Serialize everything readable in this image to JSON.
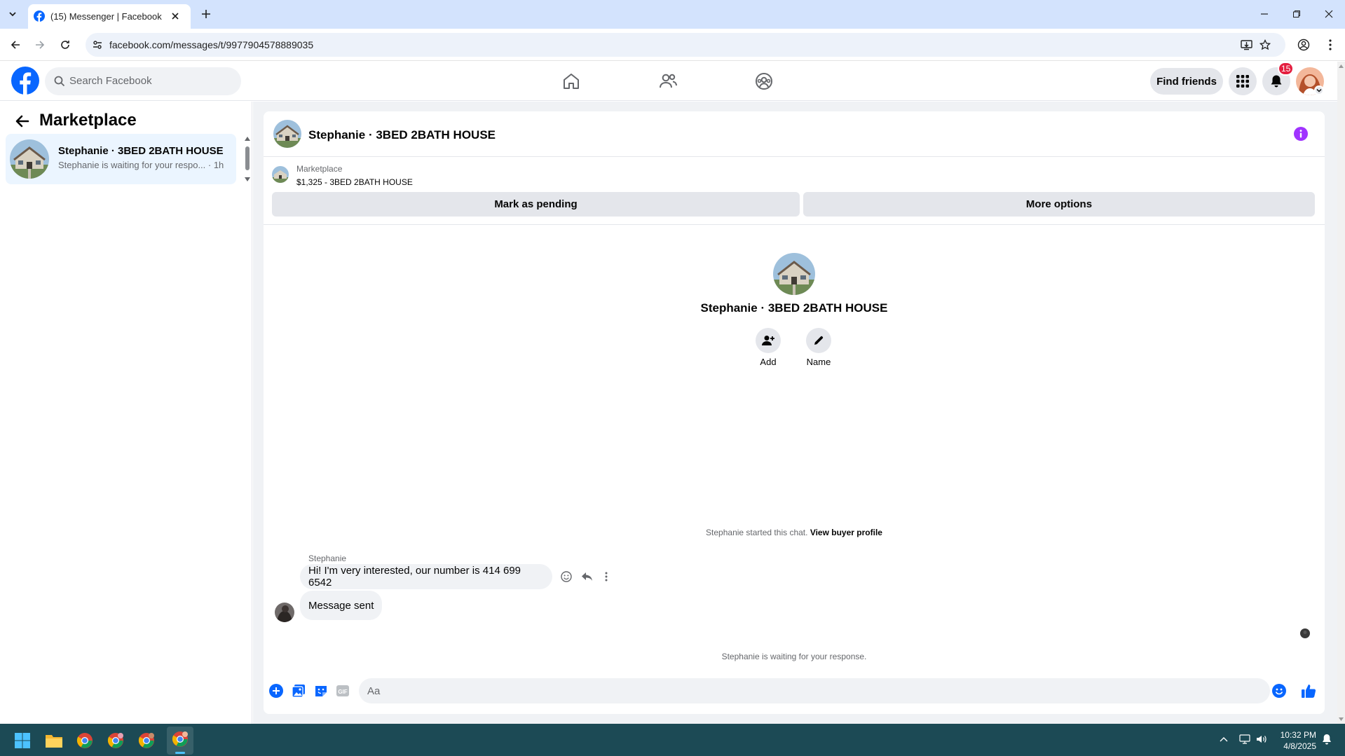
{
  "browser": {
    "tab_title": "(15) Messenger | Facebook",
    "url": "facebook.com/messages/t/9977904578889035"
  },
  "header": {
    "search_placeholder": "Search Facebook",
    "find_friends": "Find friends",
    "notification_count": "15"
  },
  "sidebar": {
    "title": "Marketplace",
    "conversations": [
      {
        "name": "Stephanie · 3BED 2BATH HOUSE",
        "preview": "Stephanie is waiting for your respo... · 1h"
      }
    ]
  },
  "chat": {
    "title": "Stephanie · 3BED 2BATH HOUSE",
    "listing": {
      "label": "Marketplace",
      "price_title": "$1,325 - 3BED 2BATH HOUSE"
    },
    "actions": {
      "mark_pending": "Mark as pending",
      "more_options": "More options"
    },
    "profile": {
      "name": "Stephanie · 3BED 2BATH HOUSE",
      "add_label": "Add",
      "name_label": "Name"
    },
    "started_text": "Stephanie started this chat.",
    "view_buyer_profile": "View buyer profile",
    "sender": "Stephanie",
    "messages": [
      {
        "text": "Hi! I'm very interested, our number is 414 699 6542"
      },
      {
        "text": "Message sent"
      }
    ],
    "waiting_text": "Stephanie is waiting for your response.",
    "composer_placeholder": "Aa"
  },
  "taskbar": {
    "time": "10:32 PM",
    "date": "4/8/2025"
  },
  "colors": {
    "brand": "#0866ff",
    "info": "#a033ff",
    "badge": "#e41e3f"
  }
}
